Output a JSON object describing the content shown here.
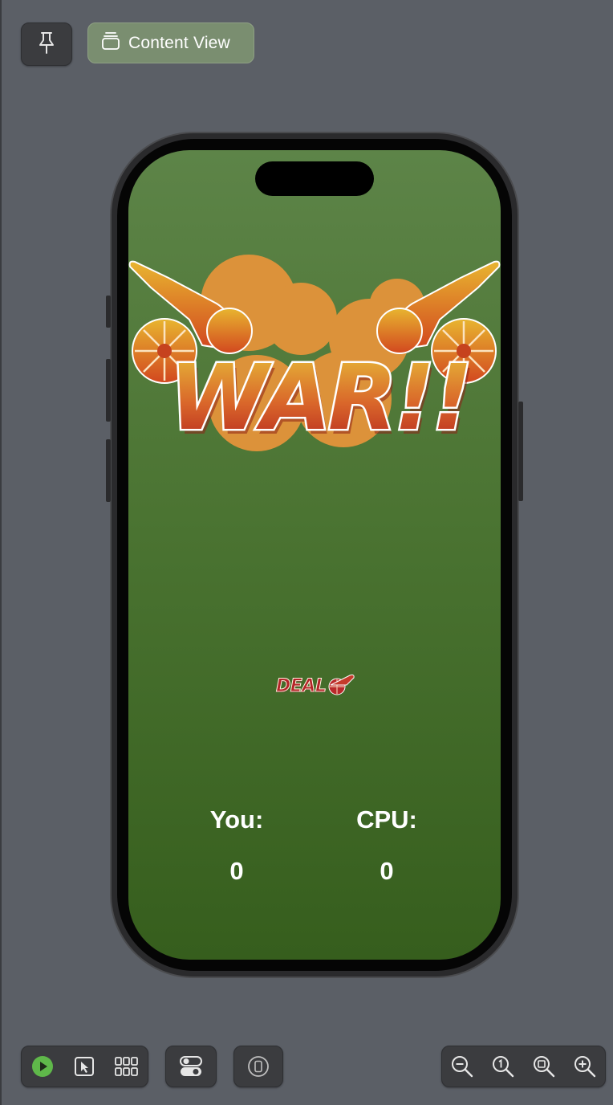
{
  "toolbar": {
    "pin_icon": "pin-icon",
    "preview_label": "Content View",
    "preview_icon": "stack-icon"
  },
  "app": {
    "title_logo_text": "WAR!!",
    "deal_button_label": "DEAL",
    "player_label": "You:",
    "player_score": "0",
    "cpu_label": "CPU:",
    "cpu_score": "0"
  },
  "bottom_toolbar": {
    "icons": [
      "play-icon",
      "select-icon",
      "grid-icon",
      "variants-toggle-icon",
      "device-settings-icon",
      "zoom-out-icon",
      "zoom-100-icon",
      "zoom-fit-icon",
      "zoom-in-icon"
    ]
  },
  "colors": {
    "canvas": "#5b5f66",
    "accent_green": "#7a8e70",
    "screen_top": "#5d8448",
    "screen_bottom": "#365e1d",
    "play_green": "#5fb84a"
  }
}
